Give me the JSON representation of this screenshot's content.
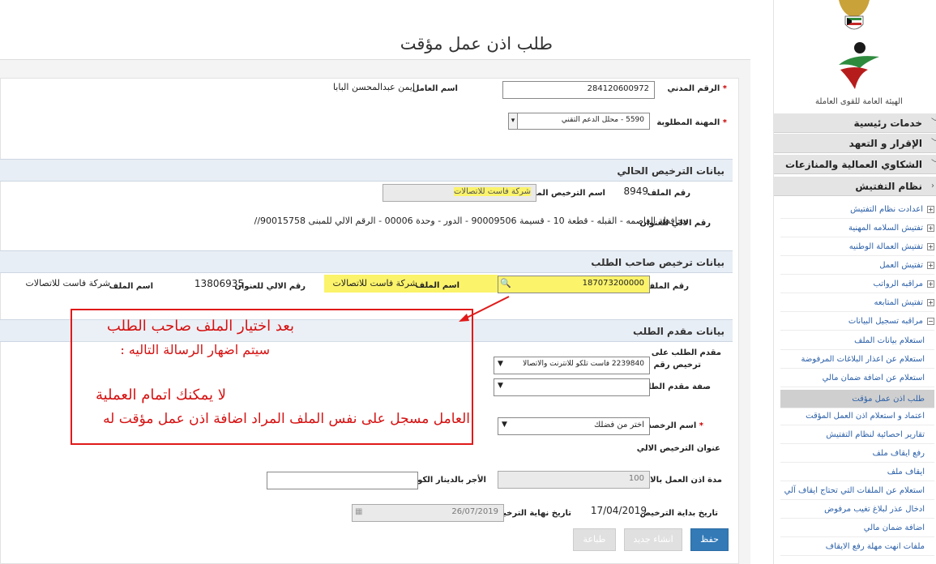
{
  "page_title": "طلب اذن عمل مؤقت",
  "sidebar": {
    "org_name": "الهيئة العامة للقوى العاملة",
    "sections": [
      "خدمات رئيسية",
      "الإقرار و التعهد",
      "الشكاوي العمالية والمنازعات",
      "نظام التفتيش"
    ],
    "sub_items": [
      "اعدادت نظام التفتيش",
      "تفتيش السلامه المهنية",
      "تفتيش العمالة الوطنيه",
      "تفتيش العمل",
      "مراقبه الرواتب",
      "تفتيش المتابعه",
      "مراقبه تسجيل البيانات"
    ],
    "leaf_items": [
      "استعلام بيانات الملف",
      "استعلام عن اعذار البلاغات المرفوضة",
      "استعلام عن اضافة ضمان مالي",
      "طلب اذن عمل مؤقت",
      "اعتماد و استعلام اذن العمل المؤقت",
      "تقارير احصائية لنظام التفتيش",
      "رفع ايقاف ملف",
      "ايقاف ملف",
      "استعلام عن الملفات التي تحتاج ايقاف آلي",
      "ادخال عذر لبلاغ تغيب مرفوض",
      "اضافة ضمان مالي",
      "ملفات انهت مهلة رفع الايقاف"
    ],
    "active_item": "طلب اذن عمل مؤقت",
    "icons": {
      "collapsed": "chevron-down-icon",
      "expand": "plus-box-icon"
    }
  },
  "worker": {
    "civil_id_label": "الرقم المدني",
    "civil_id": "284120600972",
    "name_label": "اسم العامل",
    "name": "ايمن عبدالمحسن البابا",
    "occupation_label": "المهنة المطلوبة",
    "occupation": "5590 - محلل الدعم التقني"
  },
  "current_license": {
    "section_title": "بيانات الترخيص الحالي",
    "file_no_label": "رقم الملف",
    "file_no": "8949",
    "license_name_label": "اسم الترخيص المدني",
    "license_name": "شركة فاست للاتصالات",
    "address_label": "رقم الالي للعنوان",
    "address": "محافظة العاصمه - القبله - قطعة 10 - قسيمة 90009506 - الدور - وحدة 00006 - الرقم الالي للمبنى 90015758//"
  },
  "employer_license": {
    "section_title": "بيانات ترخيص صاحب الطلب",
    "file_no_label": "رقم الملف",
    "file_no": "187073200000",
    "file_name_label": "اسم الملف",
    "file_name": "شركة فاست للاتصالات",
    "auto_address_label": "رقم الالي للعنوان",
    "auto_address": "13806935",
    "file_name_label_2": "اسم الملف",
    "file_name_2": "شركة فاست للاتصالات"
  },
  "applicant": {
    "section_title": "بيانات مقدم الطلب",
    "applicant_license_label_1": "مقدم الطلب على",
    "applicant_license_label_2": "ترخيص رقم",
    "applicant_license_value": "2239840 فاست تلكو للانترنت والاتصالا",
    "applicant_role_label": "صفة مقدم الطلب",
    "applicant_role_value": ""
  },
  "permit": {
    "license_name_label": "اسم الرخصة",
    "license_name_placeholder": "اختر من فضلك",
    "license_address_label": "عنوان الترخيص الالي",
    "duration_label": "مدة اذن العمل بالايام",
    "duration_value": "100",
    "wage_label": "الأجر بالدينار الكويتي",
    "wage_value": "",
    "start_date_label": "تاريخ بداية الترخيص",
    "start_date": "17/04/2019",
    "end_date_label": "تاريخ نهاية الترخيص",
    "end_date": "26/07/2019"
  },
  "buttons": {
    "save": "حفظ",
    "new": "انشاء جديد",
    "print": "طباعة"
  },
  "annotation": {
    "line1": "بعد اختيار الملف صاحب الطلب",
    "line2": "سيتم اضهار الرسالة التاليه :",
    "line3": "لا يمكنك اتمام العملية",
    "line4": "العامل مسجل على نفس الملف المراد اضافة اذن عمل مؤقت له"
  },
  "colors": {
    "annotation_red": "#e01a1a",
    "highlight_yellow": "#fbf36a",
    "primary_button": "#337ab7",
    "section_bar": "#e8eef5",
    "link_blue": "#2a5fa8"
  }
}
